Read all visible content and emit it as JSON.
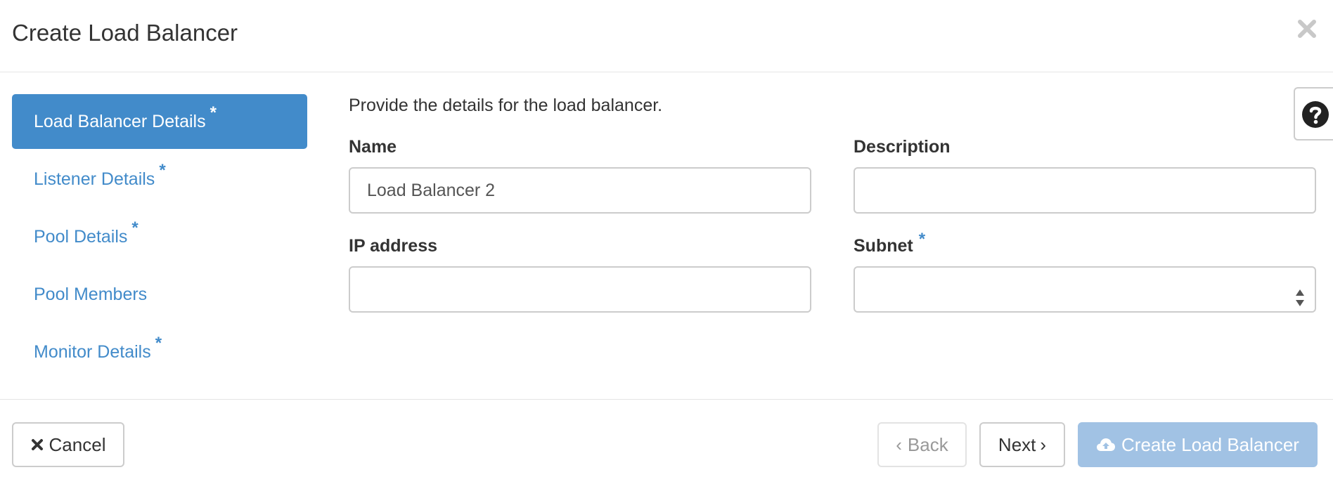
{
  "dialog": {
    "title": "Create Load Balancer"
  },
  "nav": {
    "items": [
      {
        "label": "Load Balancer Details",
        "required_mark": "*"
      },
      {
        "label": "Listener Details",
        "required_mark": "*"
      },
      {
        "label": "Pool Details",
        "required_mark": "*"
      },
      {
        "label": "Pool Members",
        "required_mark": ""
      },
      {
        "label": "Monitor Details",
        "required_mark": "*"
      }
    ],
    "active_index": 0
  },
  "form": {
    "intro": "Provide the details for the load balancer.",
    "name": {
      "label": "Name",
      "value": "Load Balancer 2"
    },
    "description": {
      "label": "Description",
      "value": ""
    },
    "ip_address": {
      "label": "IP address",
      "value": ""
    },
    "subnet": {
      "label": "Subnet",
      "required_mark": "*",
      "value": ""
    }
  },
  "footer": {
    "cancel_label": "Cancel",
    "back_label": "Back",
    "next_label": "Next",
    "create_label": "Create Load Balancer"
  },
  "icons": {
    "close": "close-icon",
    "help": "question-circle-icon",
    "cancel": "times-icon",
    "create": "cloud-upload-icon",
    "select": "select-arrows-icon"
  },
  "colors": {
    "accent": "#428bca",
    "create_button_disabled": "#a1c2e4",
    "border": "#cccccc"
  }
}
